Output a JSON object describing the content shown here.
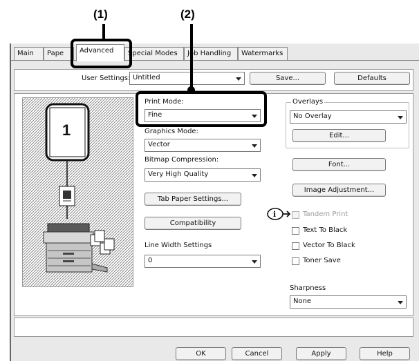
{
  "callouts": {
    "one": "(1)",
    "two": "(2)"
  },
  "tabs": [
    "Main",
    "Pape",
    "Advanced",
    "Special Modes",
    "Job Handling",
    "Watermarks"
  ],
  "user_settings": {
    "label": "User Settings:",
    "value": "Untitled",
    "save": "Save...",
    "defaults": "Defaults"
  },
  "preview": {
    "page_number": "1"
  },
  "print_mode": {
    "label": "Print Mode:",
    "value": "Fine"
  },
  "graphics_mode": {
    "label": "Graphics Mode:",
    "value": "Vector"
  },
  "bitmap_compression": {
    "label": "Bitmap Compression:",
    "value": "Very High Quality"
  },
  "tab_paper_settings": "Tab Paper Settings...",
  "compatibility": "Compatibility",
  "line_width": {
    "label": "Line Width Settings",
    "value": "0"
  },
  "overlays": {
    "label": "Overlays",
    "value": "No Overlay",
    "edit": "Edit..."
  },
  "font_button": "Font...",
  "image_adjustment_button": "Image Adjustment...",
  "checkboxes": {
    "tandem_print": "Tandem Print",
    "text_to_black": "Text To Black",
    "vector_to_black": "Vector To Black",
    "toner_save": "Toner Save"
  },
  "sharpness": {
    "label": "Sharpness",
    "value": "None"
  },
  "footer": {
    "ok": "OK",
    "cancel": "Cancel",
    "apply": "Apply",
    "help": "Help"
  }
}
